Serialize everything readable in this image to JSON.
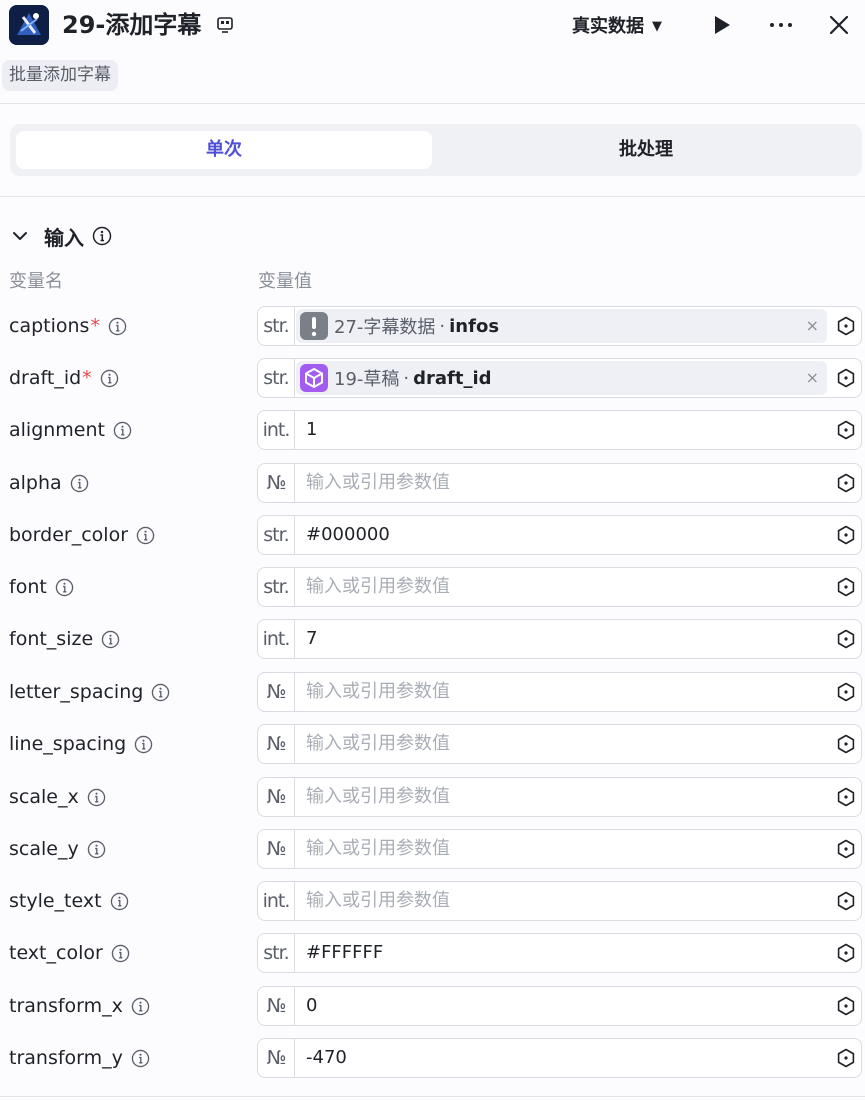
{
  "header": {
    "title": "29-添加字幕",
    "subtitle": "批量添加字幕",
    "data_mode": "真实数据",
    "data_mode_caret": "▼"
  },
  "tabs": [
    {
      "label": "单次",
      "active": true
    },
    {
      "label": "批处理",
      "active": false
    }
  ],
  "inputs": {
    "section_title": "输入",
    "col_name": "变量名",
    "col_value": "变量值",
    "placeholder": "输入或引用参数值",
    "params": [
      {
        "name": "captions",
        "required": "*",
        "type": "str.",
        "ref": {
          "node": "27-字幕数据",
          "sep": "·",
          "field": "infos",
          "badge_color": "#7b7f88",
          "badge_icon": "exclamation-icon"
        },
        "clear": "×"
      },
      {
        "name": "draft_id",
        "required": "*",
        "type": "str.",
        "ref": {
          "node": "19-草稿",
          "sep": "·",
          "field": "draft_id",
          "badge_color": "#a35cf0",
          "badge_icon": "cube-icon"
        },
        "clear": "×"
      },
      {
        "name": "alignment",
        "type": "int.",
        "value": "1"
      },
      {
        "name": "alpha",
        "type": "№",
        "value": ""
      },
      {
        "name": "border_color",
        "type": "str.",
        "value": "#000000"
      },
      {
        "name": "font",
        "type": "str.",
        "value": ""
      },
      {
        "name": "font_size",
        "type": "int.",
        "value": "7"
      },
      {
        "name": "letter_spacing",
        "type": "№",
        "value": ""
      },
      {
        "name": "line_spacing",
        "type": "№",
        "value": ""
      },
      {
        "name": "scale_x",
        "type": "№",
        "value": ""
      },
      {
        "name": "scale_y",
        "type": "№",
        "value": ""
      },
      {
        "name": "style_text",
        "type": "int.",
        "value": ""
      },
      {
        "name": "text_color",
        "type": "str.",
        "value": "#FFFFFF"
      },
      {
        "name": "transform_x",
        "type": "№",
        "value": "0"
      },
      {
        "name": "transform_y",
        "type": "№",
        "value": "-470"
      }
    ]
  },
  "colors": {
    "accent": "#4e51d6",
    "required": "#e5484d"
  }
}
